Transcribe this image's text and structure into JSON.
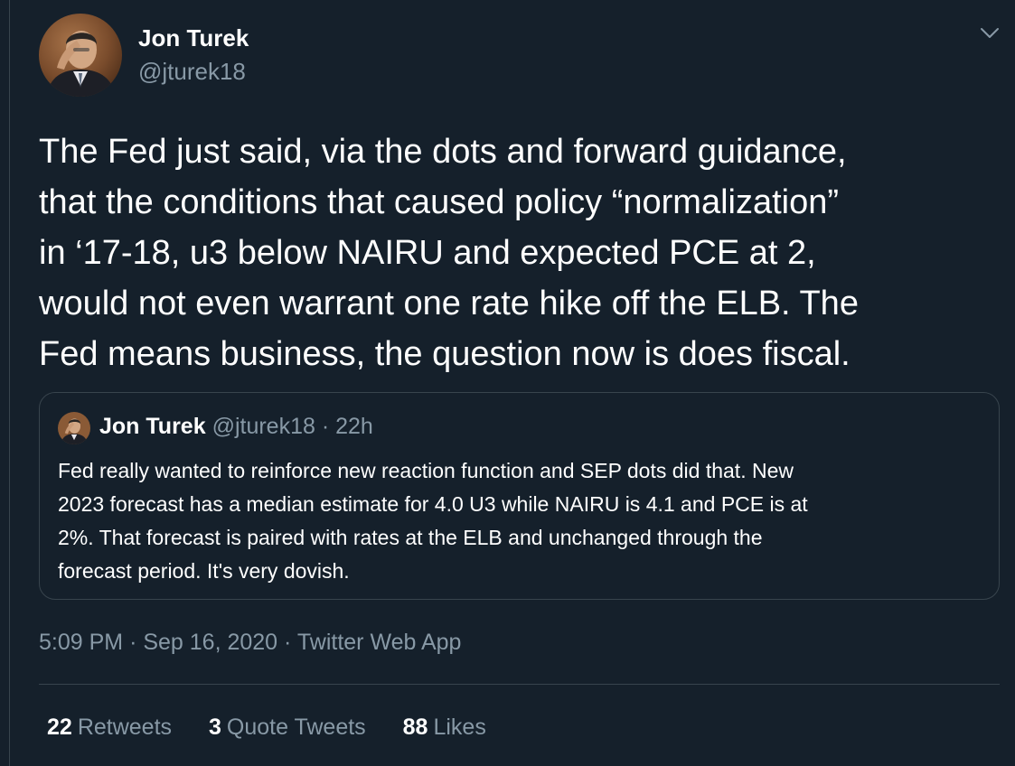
{
  "tweet": {
    "author": {
      "name": "Jon Turek",
      "handle": "@jturek18"
    },
    "text_lines": [
      "The Fed just said, via the dots and forward guidance,",
      "that the conditions that caused policy “normalization”",
      "in ‘17-18, u3 below NAIRU and expected PCE at 2,",
      "would not even warrant one rate hike off the ELB. The",
      "Fed means business, the question now is does fiscal."
    ],
    "quoted": {
      "name": "Jon Turek",
      "meta": "@jturek18 · 22h",
      "text_lines": [
        "Fed really wanted to reinforce new reaction function and SEP dots did that. New",
        "2023 forecast has a median estimate for 4.0 U3 while NAIRU is 4.1 and PCE is at",
        "2%. That forecast is paired with rates at the ELB and unchanged through the",
        "forecast period. It's very dovish."
      ]
    },
    "time": "5:09 PM",
    "separator": "·",
    "date": "Sep 16, 2020",
    "source": "Twitter Web App",
    "stats": {
      "retweets": {
        "count": "22",
        "label": "Retweets"
      },
      "quote_tweets": {
        "count": "3",
        "label": "Quote Tweets"
      },
      "likes": {
        "count": "88",
        "label": "Likes"
      }
    }
  },
  "colors": {
    "background": "#15202b",
    "text_primary": "#ffffff",
    "text_secondary": "#8899a6",
    "border": "#38444d"
  },
  "icons": {
    "more": "chevron-down-icon"
  }
}
